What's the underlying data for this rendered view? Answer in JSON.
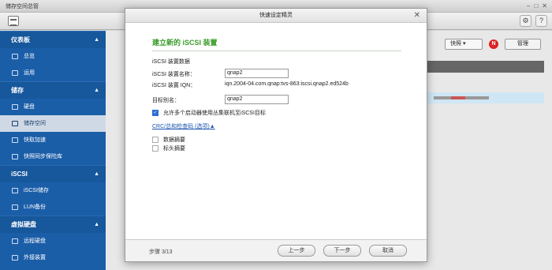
{
  "window": {
    "title": "储存空间总管"
  },
  "sidebar": {
    "sections": [
      {
        "label": "仪表板",
        "items": [
          {
            "label": "总览"
          },
          {
            "label": "运用"
          }
        ]
      },
      {
        "label": "储存",
        "items": [
          {
            "label": "硬盘"
          },
          {
            "label": "储存空间"
          },
          {
            "label": "快取加速"
          },
          {
            "label": "快照同步保险库"
          }
        ]
      },
      {
        "label": "iSCSI",
        "items": [
          {
            "label": "iSCSI储存"
          },
          {
            "label": "LUN备份"
          }
        ]
      },
      {
        "label": "虚拟硬盘",
        "items": [
          {
            "label": "远程硬盘"
          },
          {
            "label": "外接装置"
          }
        ]
      }
    ]
  },
  "main": {
    "snapshot_label": "快照",
    "badge": "N",
    "manage_label": "管理"
  },
  "dialog": {
    "title": "快速设定精灵",
    "heading": "建立新的 iSCSI 装置",
    "section_label": "iSCSI 装置数据",
    "name_label": "iSCSI 装置名称：",
    "name_value": "qnap2",
    "iqn_label": "iSCSI 装置 IQN：",
    "iqn_value": "iqn.2004-04.com.qnap:tvs-863:iscsi.qnap2.ed524b",
    "alias_label": "目标别名：",
    "alias_value": "qnap2",
    "cluster_label": "允许多个启动器使用丛集联机至iSCSI目标",
    "crc_link": "CRC/总和检查码 (选项)▲",
    "data_digest": "数据摘要",
    "header_digest": "标头摘要",
    "step": "步骤 3/13",
    "prev": "上一步",
    "next": "下一步",
    "cancel": "取消"
  },
  "colors": {
    "sidebar": "#1b5ea8",
    "heading": "#3a9d2a",
    "link": "#1a55b0"
  }
}
